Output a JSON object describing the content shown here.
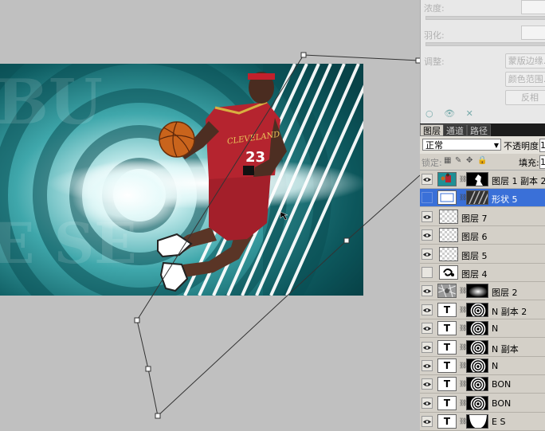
{
  "mask_panel": {
    "density_label": "浓度:",
    "feather_label": "羽化:",
    "adjust_label": "调整:",
    "buttons": [
      "蒙版边缘...",
      "颜色范围...",
      "反相"
    ]
  },
  "layers_panel": {
    "tabs": [
      "图层",
      "通道",
      "路径"
    ],
    "blend_mode": "正常",
    "opacity_label": "不透明度:",
    "opacity_value": "1",
    "lock_label": "锁定:",
    "fill_label": "填充:",
    "fill_value": "1",
    "layers": [
      {
        "name": "图层 1 副本 2",
        "thumb": "photo",
        "mask": "figure",
        "visible": true,
        "selected": false
      },
      {
        "name": "形状 5",
        "thumb": "shape",
        "mask": "stripes",
        "visible": false,
        "selected": true
      },
      {
        "name": "图层 7",
        "thumb": "checker",
        "mask": "none",
        "visible": true,
        "selected": false
      },
      {
        "name": "图层 6",
        "thumb": "checker",
        "mask": "none",
        "visible": true,
        "selected": false
      },
      {
        "name": "图层 5",
        "thumb": "checker",
        "mask": "none",
        "visible": true,
        "selected": false
      },
      {
        "name": "图层 4",
        "thumb": "swirl",
        "mask": "none",
        "visible": false,
        "selected": false
      },
      {
        "name": "图层 2",
        "thumb": "texture",
        "mask": "glow",
        "visible": true,
        "selected": false
      },
      {
        "name": "N 副本 2",
        "thumb": "T",
        "mask": "rings",
        "visible": true,
        "selected": false
      },
      {
        "name": "N",
        "thumb": "T",
        "mask": "rings",
        "visible": true,
        "selected": false
      },
      {
        "name": "N 副本",
        "thumb": "T",
        "mask": "rings",
        "visible": true,
        "selected": false
      },
      {
        "name": "N",
        "thumb": "T",
        "mask": "rings",
        "visible": true,
        "selected": false
      },
      {
        "name": "BON",
        "thumb": "T",
        "mask": "rings",
        "visible": true,
        "selected": false
      },
      {
        "name": "BON",
        "thumb": "T",
        "mask": "rings",
        "visible": true,
        "selected": false
      },
      {
        "name": "E S",
        "thumb": "T",
        "mask": "white-shape",
        "visible": true,
        "selected": false
      }
    ]
  },
  "artwork": {
    "jersey_text": "CLEVELAND",
    "jersey_number": "23",
    "background_letters": "BU E SE",
    "colors": {
      "teal": "#1f8f95",
      "jersey": "#b5242f",
      "accent": "#d8b040"
    }
  }
}
